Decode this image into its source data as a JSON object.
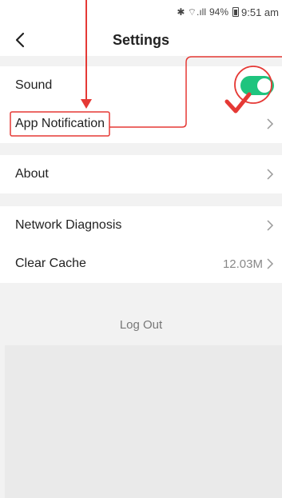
{
  "status_bar": {
    "battery": "94%",
    "time": "9:51 am",
    "signal_glyphs": "✱ ⌔.ıll"
  },
  "header": {
    "title": "Settings"
  },
  "sections": {
    "sound_group": [
      {
        "label": "Sound",
        "toggle_on": true
      },
      {
        "label": "App Notification"
      }
    ],
    "about_group": [
      {
        "label": "About"
      }
    ],
    "misc_group": [
      {
        "label": "Network Diagnosis"
      },
      {
        "label": "Clear Cache",
        "value": "12.03M"
      }
    ]
  },
  "logout": {
    "label": "Log Out"
  },
  "colors": {
    "toggle_on": "#1fc47e",
    "annotation": "#e53935"
  }
}
